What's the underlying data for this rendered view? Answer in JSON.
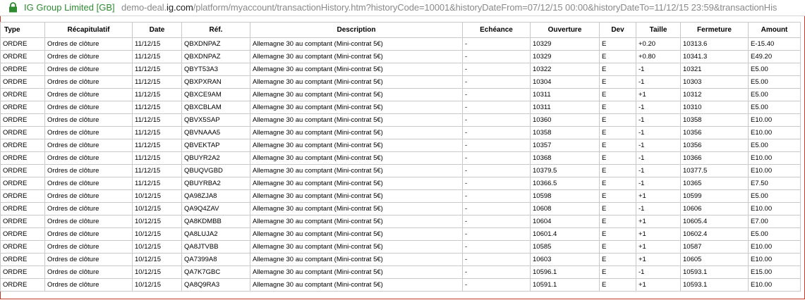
{
  "address_bar": {
    "site_identity": "IG Group Limited [GB]",
    "url_prefix": "demo-deal.",
    "url_domain": "ig.com",
    "url_path": "/platform/myaccount/transactionHistory.htm?historyCode=10001&historyDateFrom=07/12/15 00:00&historyDateTo=11/12/15 23:59&transactionHis",
    "secure_color": "#2e8b32"
  },
  "table": {
    "headers": [
      "Type",
      "Récapitulatif",
      "Date",
      "Réf.",
      "Description",
      "Echéance",
      "Ouverture",
      "Dev",
      "Taille",
      "Fermeture",
      "Amount"
    ],
    "rows": [
      [
        "ORDRE",
        "Ordres de clôture",
        "11/12/15",
        "QBXDNPAZ",
        "Allemagne 30 au comptant (Mini-contrat 5€)",
        "-",
        "10329",
        "E",
        "+0.20",
        "10313.6",
        "E-15.40"
      ],
      [
        "ORDRE",
        "Ordres de clôture",
        "11/12/15",
        "QBXDNPAZ",
        "Allemagne 30 au comptant (Mini-contrat 5€)",
        "-",
        "10329",
        "E",
        "+0.80",
        "10341.3",
        "E49.20"
      ],
      [
        "ORDRE",
        "Ordres de clôture",
        "11/12/15",
        "QBYT53A3",
        "Allemagne 30 au comptant (Mini-contrat 5€)",
        "-",
        "10322",
        "E",
        "-1",
        "10321",
        "E5.00"
      ],
      [
        "ORDRE",
        "Ordres de clôture",
        "11/12/15",
        "QBXPXRAN",
        "Allemagne 30 au comptant (Mini-contrat 5€)",
        "-",
        "10304",
        "E",
        "-1",
        "10303",
        "E5.00"
      ],
      [
        "ORDRE",
        "Ordres de clôture",
        "11/12/15",
        "QBXCE9AM",
        "Allemagne 30 au comptant (Mini-contrat 5€)",
        "-",
        "10311",
        "E",
        "+1",
        "10312",
        "E5.00"
      ],
      [
        "ORDRE",
        "Ordres de clôture",
        "11/12/15",
        "QBXCBLAM",
        "Allemagne 30 au comptant (Mini-contrat 5€)",
        "-",
        "10311",
        "E",
        "-1",
        "10310",
        "E5.00"
      ],
      [
        "ORDRE",
        "Ordres de clôture",
        "11/12/15",
        "QBVX5SAP",
        "Allemagne 30 au comptant (Mini-contrat 5€)",
        "-",
        "10360",
        "E",
        "-1",
        "10358",
        "E10.00"
      ],
      [
        "ORDRE",
        "Ordres de clôture",
        "11/12/15",
        "QBVNAAA5",
        "Allemagne 30 au comptant (Mini-contrat 5€)",
        "-",
        "10358",
        "E",
        "-1",
        "10356",
        "E10.00"
      ],
      [
        "ORDRE",
        "Ordres de clôture",
        "11/12/15",
        "QBVEKTAP",
        "Allemagne 30 au comptant (Mini-contrat 5€)",
        "-",
        "10357",
        "E",
        "-1",
        "10356",
        "E5.00"
      ],
      [
        "ORDRE",
        "Ordres de clôture",
        "11/12/15",
        "QBUYR2A2",
        "Allemagne 30 au comptant (Mini-contrat 5€)",
        "-",
        "10368",
        "E",
        "-1",
        "10366",
        "E10.00"
      ],
      [
        "ORDRE",
        "Ordres de clôture",
        "11/12/15",
        "QBUQVGBD",
        "Allemagne 30 au comptant (Mini-contrat 5€)",
        "-",
        "10379.5",
        "E",
        "-1",
        "10377.5",
        "E10.00"
      ],
      [
        "ORDRE",
        "Ordres de clôture",
        "11/12/15",
        "QBUYRBA2",
        "Allemagne 30 au comptant (Mini-contrat 5€)",
        "-",
        "10366.5",
        "E",
        "-1",
        "10365",
        "E7.50"
      ],
      [
        "ORDRE",
        "Ordres de clôture",
        "10/12/15",
        "QA98ZJA8",
        "Allemagne 30 au comptant (Mini-contrat 5€)",
        "-",
        "10598",
        "E",
        "+1",
        "10599",
        "E5.00"
      ],
      [
        "ORDRE",
        "Ordres de clôture",
        "10/12/15",
        "QA9Q4ZAV",
        "Allemagne 30 au comptant (Mini-contrat 5€)",
        "-",
        "10608",
        "E",
        "-1",
        "10606",
        "E10.00"
      ],
      [
        "ORDRE",
        "Ordres de clôture",
        "10/12/15",
        "QA8KDMBB",
        "Allemagne 30 au comptant (Mini-contrat 5€)",
        "-",
        "10604",
        "E",
        "+1",
        "10605.4",
        "E7.00"
      ],
      [
        "ORDRE",
        "Ordres de clôture",
        "10/12/15",
        "QA8LUJA2",
        "Allemagne 30 au comptant (Mini-contrat 5€)",
        "-",
        "10601.4",
        "E",
        "+1",
        "10602.4",
        "E5.00"
      ],
      [
        "ORDRE",
        "Ordres de clôture",
        "10/12/15",
        "QA8JTVBB",
        "Allemagne 30 au comptant (Mini-contrat 5€)",
        "-",
        "10585",
        "E",
        "+1",
        "10587",
        "E10.00"
      ],
      [
        "ORDRE",
        "Ordres de clôture",
        "10/12/15",
        "QA7399A8",
        "Allemagne 30 au comptant (Mini-contrat 5€)",
        "-",
        "10603",
        "E",
        "+1",
        "10605",
        "E10.00"
      ],
      [
        "ORDRE",
        "Ordres de clôture",
        "10/12/15",
        "QA7K7GBC",
        "Allemagne 30 au comptant (Mini-contrat 5€)",
        "-",
        "10596.1",
        "E",
        "-1",
        "10593.1",
        "E15.00"
      ],
      [
        "ORDRE",
        "Ordres de clôture",
        "10/12/15",
        "QA8Q9RA3",
        "Allemagne 30 au comptant (Mini-contrat 5€)",
        "-",
        "10591.1",
        "E",
        "+1",
        "10593.1",
        "E10.00"
      ]
    ]
  }
}
